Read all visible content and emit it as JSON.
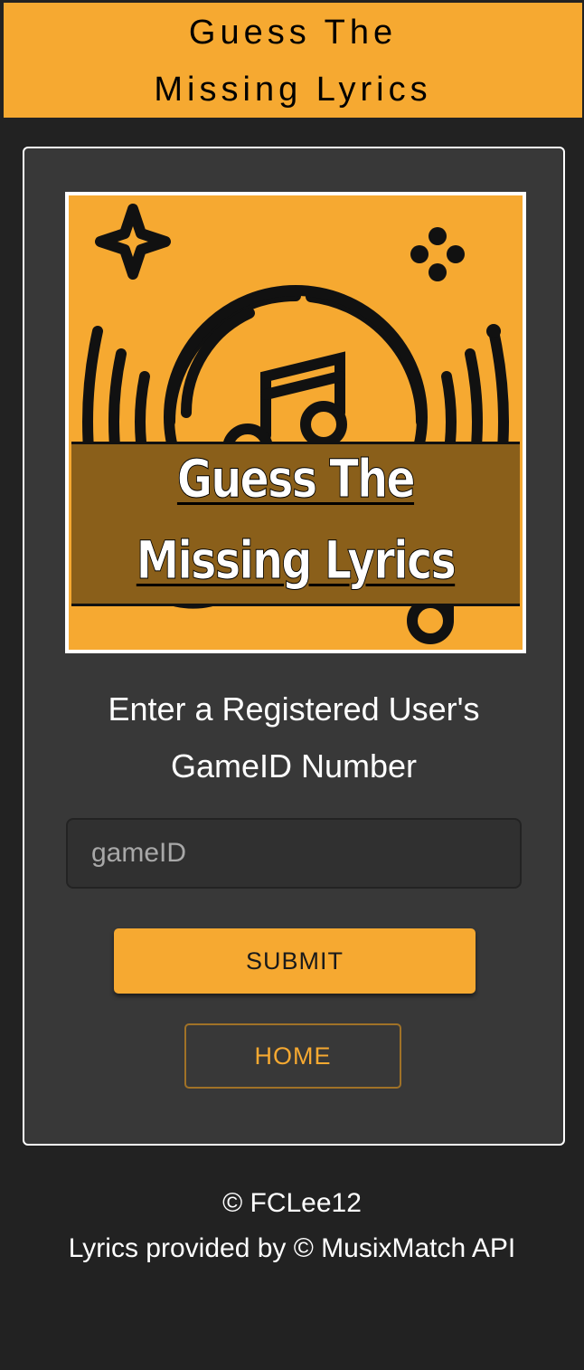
{
  "header": {
    "title_line1": "Guess The",
    "title_line2": "Missing Lyrics"
  },
  "logo": {
    "title_line1": "Guess The",
    "title_line2": "Missing Lyrics",
    "background_color": "#F6A931",
    "band_color": "#8A5F1A",
    "icon": "music-disc-icon"
  },
  "form": {
    "prompt_line1": "Enter a Registered User's",
    "prompt_line2": "GameID Number",
    "input_placeholder": "gameID",
    "input_value": "",
    "submit_label": "SUBMIT",
    "home_label": "HOME"
  },
  "footer": {
    "copyright": "© FCLee12",
    "credit": "Lyrics provided by © MusixMatch API"
  },
  "colors": {
    "accent": "#F6A931",
    "page_background": "#222222",
    "card_background": "#383838"
  }
}
